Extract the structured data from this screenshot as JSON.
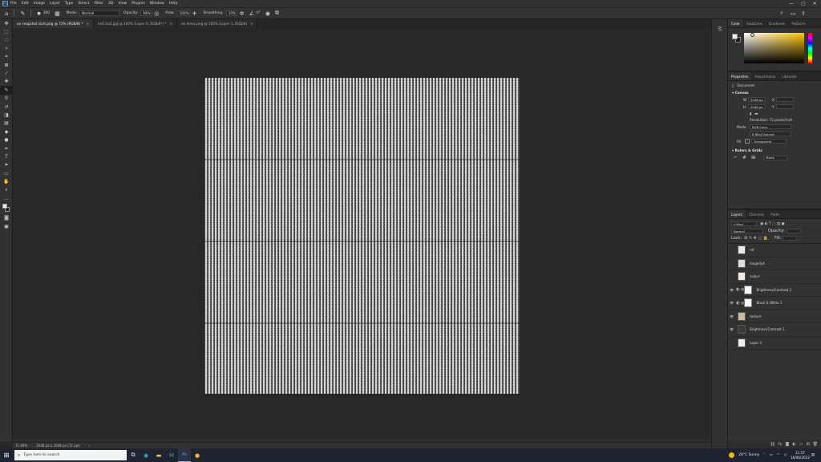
{
  "app": {
    "logo": "Ps",
    "min": "—",
    "max": "▢",
    "close": "✕"
  },
  "menu": [
    "File",
    "Edit",
    "Image",
    "Layer",
    "Type",
    "Select",
    "Filter",
    "3D",
    "View",
    "Plugins",
    "Window",
    "Help"
  ],
  "options": {
    "brush_size": "300",
    "mode_label": "Mode:",
    "mode_value": "Normal",
    "opacity_label": "Opacity:",
    "opacity_value": "94%",
    "flow_label": "Flow:",
    "flow_value": "100%",
    "smoothing_label": "Smoothing:",
    "smoothing_value": "10%",
    "angle_value": "0°"
  },
  "tabs": [
    {
      "label": "uv snapshot skirt.png @ 72% (RGB/8) *",
      "active": true
    },
    {
      "label": "knit test.jpg @ 100% (Layer 0, RGB/8*) *",
      "active": false
    },
    {
      "label": "ao dress.png @ 100% (Layer 1, RGB/8)",
      "active": false
    }
  ],
  "status": {
    "zoom": "71.99%",
    "doc": "2048 px x 2048 px (72 ppi)"
  },
  "color_panel": {
    "tabs": [
      "Color",
      "Swatches",
      "Gradients",
      "Patterns"
    ],
    "fg_color": "#f2ecde",
    "bg_color": "#1b1b1b"
  },
  "properties": {
    "tabs": [
      "Properties",
      "Adjustments",
      "Libraries"
    ],
    "doc_label": "Document",
    "canvas_title": "Canvas",
    "w_label": "W",
    "w_value": "2048 px",
    "h_label": "H",
    "h_value": "2048 px",
    "x_label": "X",
    "y_label": "Y",
    "resolution": "Resolution: 72 pixels/inch",
    "mode_label": "Mode",
    "mode_value": "RGB Color",
    "bit_value": "8 Bits/Channel",
    "fill_label": "Fill",
    "fill_value": "Transparent",
    "rulers_title": "Rulers & Grids",
    "units_value": "Pixels"
  },
  "layers": {
    "tabs": [
      "Layers",
      "Channels",
      "Paths"
    ],
    "kind_label": "Kind",
    "blend_value": "Normal",
    "opacity_label": "Opacity:",
    "lock_label": "Lock:",
    "fill_label": "Fill:",
    "items": [
      {
        "name": "ref",
        "visible": false,
        "type": "pixel",
        "thumb": "#e8e8e8"
      },
      {
        "name": "magnify4",
        "visible": false,
        "type": "pixel",
        "thumb": "#dcdcdc"
      },
      {
        "name": "colour",
        "visible": false,
        "type": "pixel",
        "thumb": "#f2ecde"
      },
      {
        "name": "Brightness/Contrast 2",
        "visible": true,
        "type": "adjust",
        "thumb": "#ffffff"
      },
      {
        "name": "Black & White 1",
        "visible": true,
        "type": "adjust",
        "thumb": "#ffffff"
      },
      {
        "name": "texture",
        "visible": true,
        "type": "pixel",
        "thumb": "#cbb9a2"
      },
      {
        "name": "Brightness/Contrast 1",
        "visible": true,
        "type": "pixel",
        "thumb": "#3a3a3a"
      },
      {
        "name": "Layer 3",
        "visible": false,
        "type": "pixel",
        "thumb": "#eeeeee"
      }
    ]
  },
  "taskbar": {
    "search_placeholder": "Type here to search",
    "weather": "26°C  Sunny",
    "time": "11:57",
    "date": "16/06/2022"
  }
}
